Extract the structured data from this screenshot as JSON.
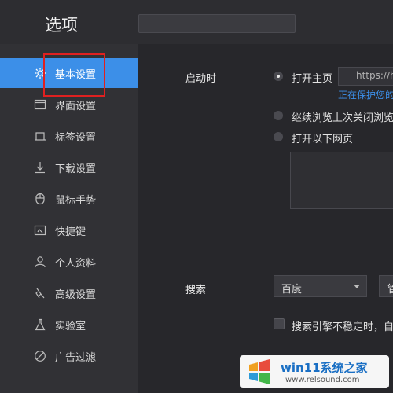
{
  "window": {
    "title": "选项"
  },
  "sidebar": {
    "items": [
      {
        "label": "基本设置",
        "icon": "gear-icon",
        "active": true
      },
      {
        "label": "界面设置",
        "icon": "window-icon"
      },
      {
        "label": "标签设置",
        "icon": "tab-icon"
      },
      {
        "label": "下载设置",
        "icon": "download-icon"
      },
      {
        "label": "鼠标手势",
        "icon": "mouse-icon"
      },
      {
        "label": "快捷键",
        "icon": "shortcut-icon"
      },
      {
        "label": "个人资料",
        "icon": "user-icon"
      },
      {
        "label": "高级设置",
        "icon": "advanced-icon"
      },
      {
        "label": "实验室",
        "icon": "flask-icon"
      },
      {
        "label": "广告过滤",
        "icon": "block-icon"
      }
    ]
  },
  "startup": {
    "label": "启动时",
    "options": [
      {
        "label": "打开主页",
        "checked": true
      },
      {
        "label": "继续浏览上次关闭浏览",
        "checked": false
      },
      {
        "label": "打开以下网页",
        "checked": false
      }
    ],
    "homepage_value": "https://h",
    "protect_link": "正在保护您的"
  },
  "search": {
    "label": "搜索",
    "engine": "百度",
    "second_select": "管",
    "fallback_label": "搜索引擎不稳定时，自"
  },
  "watermark": {
    "title": "win11系统之家",
    "url": "www.relsound.com"
  },
  "colors": {
    "accent": "#3c8fe8",
    "highlight": "#e02020"
  }
}
